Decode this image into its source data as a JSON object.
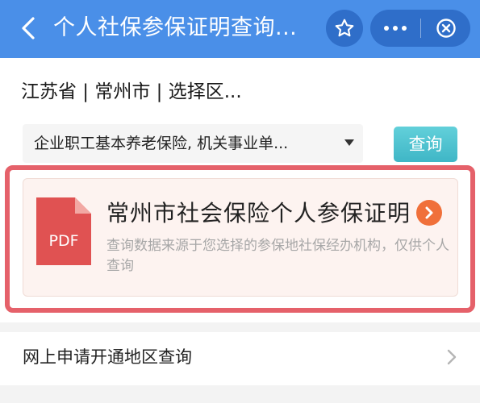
{
  "header": {
    "title": "个人社保参保证明查询...",
    "back_icon": "chevron-left-icon",
    "favorite_icon": "star-icon",
    "more_icon": "more-dots-icon",
    "close_icon": "close-circle-icon",
    "bar_color": "#4a8fe8"
  },
  "region": {
    "text": "江苏省 | 常州市 | 选择区..."
  },
  "insurance_type": {
    "selected": "企业职工基本养老保险, 机关事业单..."
  },
  "query_button": {
    "label": "查询",
    "color": "#3fb6c6"
  },
  "certificate_card": {
    "icon_label": "PDF",
    "title": "常州市社会保险个人参保证明",
    "description": "查询数据来源于您选择的参保地社保经办机构，仅供个人查询",
    "arrow_icon": "chevron-right-circle-icon",
    "highlight_color": "#e5616a"
  },
  "online_apply": {
    "label": "网上申请开通地区查询",
    "chevron_icon": "chevron-right-icon"
  }
}
